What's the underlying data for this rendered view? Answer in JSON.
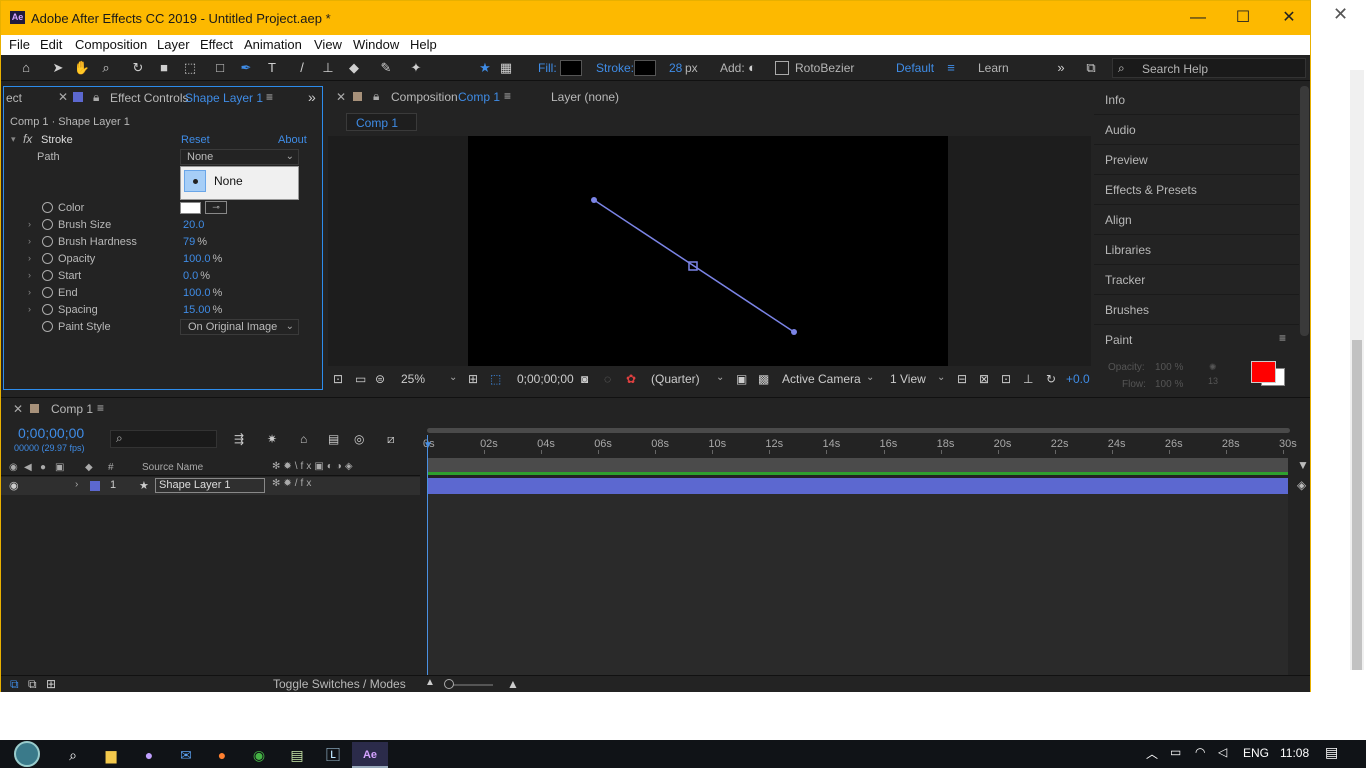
{
  "window": {
    "title": "Adobe After Effects CC 2019 - Untitled Project.aep *",
    "app_logo": "Ae"
  },
  "menu": [
    "File",
    "Edit",
    "Composition",
    "Layer",
    "Effect",
    "Animation",
    "View",
    "Window",
    "Help"
  ],
  "toolbar": {
    "fill_label": "Fill:",
    "stroke_label": "Stroke:",
    "stroke_width": "28",
    "stroke_unit": "px",
    "add_label": "Add:",
    "rotobezier_label": "RotoBezier",
    "workspace_default": "Default",
    "workspace_learn": "Learn",
    "search_placeholder": "Search Help"
  },
  "effect_controls": {
    "tab_cut": "ect",
    "tab_label": "Effect Controls",
    "tab_layer": "Shape Layer 1",
    "breadcrumb": "Comp 1 · Shape Layer 1",
    "effect_name": "Stroke",
    "reset_label": "Reset",
    "about_label": "About",
    "path_label": "Path",
    "path_value": "None",
    "dropdown_option": "None",
    "props": [
      {
        "name": "Color",
        "value": ""
      },
      {
        "name": "Brush Size",
        "value": "20.0",
        "unit": ""
      },
      {
        "name": "Brush Hardness",
        "value": "79",
        "unit": "%"
      },
      {
        "name": "Opacity",
        "value": "100.0",
        "unit": "%"
      },
      {
        "name": "Start",
        "value": "0.0",
        "unit": "%"
      },
      {
        "name": "End",
        "value": "100.0",
        "unit": "%"
      },
      {
        "name": "Spacing",
        "value": "15.00",
        "unit": "%"
      }
    ],
    "paint_style_label": "Paint Style",
    "paint_style_value": "On Original Image"
  },
  "composition": {
    "tab_label": "Composition",
    "tab_comp": "Comp 1",
    "layer_tab": "Layer (none)",
    "subtab": "Comp 1",
    "zoom": "25%",
    "timecode": "0;00;00;00",
    "resolution": "(Quarter)",
    "camera": "Active Camera",
    "views": "1 View",
    "exposure": "+0.0"
  },
  "right_panels": [
    "Info",
    "Audio",
    "Preview",
    "Effects & Presets",
    "Align",
    "Libraries",
    "Tracker",
    "Brushes",
    "Paint"
  ],
  "paint_panel": {
    "opacity_label": "Opacity:",
    "opacity_value": "100 %",
    "flow_label": "Flow:",
    "flow_value": "100 %",
    "brush_size": "13",
    "fg_color": "#ff0000",
    "bg_color": "#ffffff"
  },
  "timeline": {
    "comp_tab": "Comp 1",
    "timecode": "0;00;00;00",
    "frame_info": "00000 (29.97 fps)",
    "source_name_header": "Source Name",
    "layer_number": "1",
    "layer_name": "Shape Layer 1",
    "ruler": [
      "0s",
      "02s",
      "04s",
      "06s",
      "08s",
      "10s",
      "12s",
      "14s",
      "16s",
      "18s",
      "20s",
      "22s",
      "24s",
      "26s",
      "28s",
      "30s"
    ],
    "toggle_label": "Toggle Switches / Modes"
  },
  "taskbar": {
    "lang": "ENG",
    "time": "11:08"
  },
  "colors": {
    "accent_blue": "#3f8ce6",
    "titlebar": "#fdb900",
    "layer_bar": "#5c68d0"
  }
}
